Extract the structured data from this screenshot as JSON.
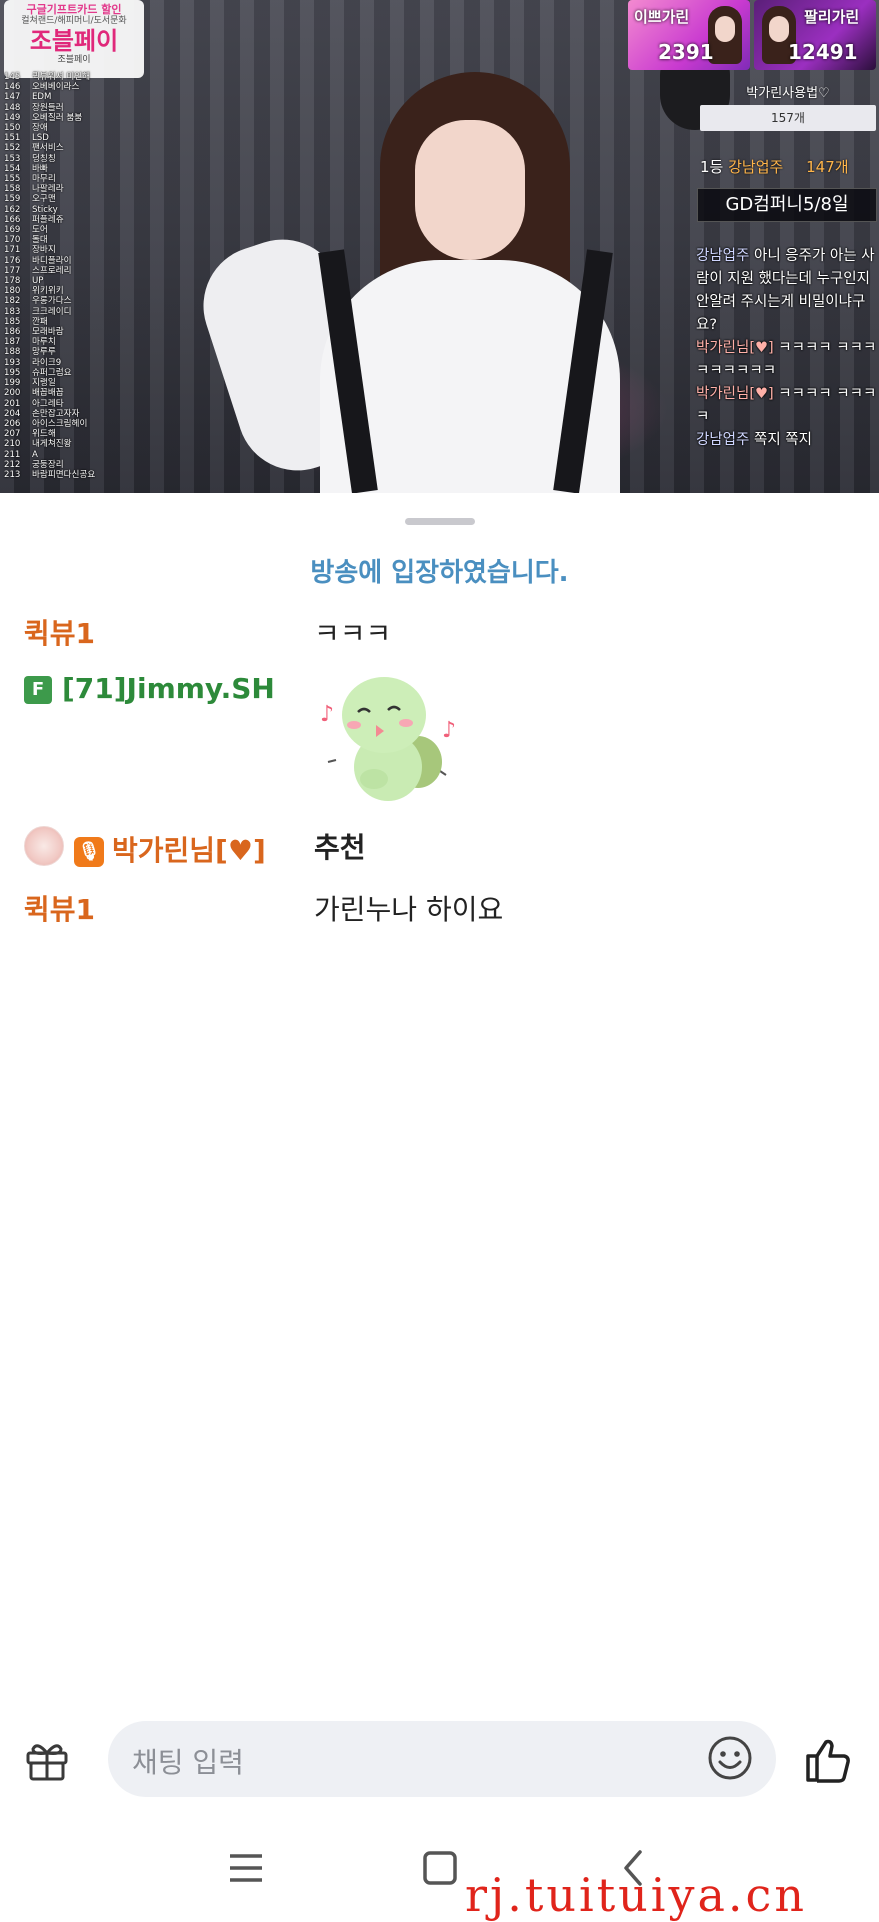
{
  "video": {
    "ad": {
      "top_line": "구글기프트카드 할인",
      "sub_line": "컬쳐랜드/해피머니/도서문화",
      "main": "조블페이",
      "foot": "조블페이"
    },
    "ranking": [
      {
        "n": "145",
        "t": "퀵뷰워셔 미인해"
      },
      {
        "n": "146",
        "t": "오베베이라스"
      },
      {
        "n": "147",
        "t": "EDM"
      },
      {
        "n": "148",
        "t": "장원들러"
      },
      {
        "n": "149",
        "t": "오베질러 붐붐"
      },
      {
        "n": "150",
        "t": "장애"
      },
      {
        "n": "151",
        "t": "LSD"
      },
      {
        "n": "152",
        "t": "팬서비스"
      },
      {
        "n": "153",
        "t": "덩칭칭"
      },
      {
        "n": "154",
        "t": "바빠"
      },
      {
        "n": "155",
        "t": "마무리"
      },
      {
        "n": "158",
        "t": "나팔레라"
      },
      {
        "n": "159",
        "t": "오구맨"
      },
      {
        "n": "162",
        "t": "Sticky"
      },
      {
        "n": "166",
        "t": "퍼플레쥬"
      },
      {
        "n": "169",
        "t": "도어"
      },
      {
        "n": "170",
        "t": "돌대"
      },
      {
        "n": "171",
        "t": "장바지"
      },
      {
        "n": "176",
        "t": "바디플라이"
      },
      {
        "n": "177",
        "t": "스프로레리"
      },
      {
        "n": "178",
        "t": "UP"
      },
      {
        "n": "180",
        "t": "위키위키"
      },
      {
        "n": "182",
        "t": "우롱가다스"
      },
      {
        "n": "183",
        "t": "크크레이디"
      },
      {
        "n": "185",
        "t": "깐패"
      },
      {
        "n": "186",
        "t": "모래바람"
      },
      {
        "n": "187",
        "t": "마루치"
      },
      {
        "n": "188",
        "t": "망루루"
      },
      {
        "n": "193",
        "t": "라이크9"
      },
      {
        "n": "195",
        "t": "슈퍼그럼요"
      },
      {
        "n": "199",
        "t": "지랭일"
      },
      {
        "n": "200",
        "t": "배꼽배꼽"
      },
      {
        "n": "201",
        "t": "아그레타"
      },
      {
        "n": "204",
        "t": "손만잡고자자"
      },
      {
        "n": "206",
        "t": "아이스크림헤이"
      },
      {
        "n": "207",
        "t": "위드해"
      },
      {
        "n": "210",
        "t": "내게쳐진왕"
      },
      {
        "n": "211",
        "t": "A"
      },
      {
        "n": "212",
        "t": "궁둥장리"
      },
      {
        "n": "213",
        "t": "바람피면다신공요"
      }
    ],
    "thumbs": [
      {
        "label": "이쁘가린",
        "num": "2391"
      },
      {
        "label": "팔리가린",
        "num": "12491"
      }
    ],
    "right_title": "박가린사용법♡",
    "right_count": "157개",
    "rank_line": {
      "rank": "1등",
      "name": "강남업주",
      "count": "147개"
    },
    "gd": "GD컴퍼니5/8일",
    "overlay_chat": [
      {
        "name": "강남업주",
        "text": "아니 응주가 아는 사람이 지원 했다는데 누구인지 안알려 주시는게 비밀이냐구요?"
      },
      {
        "name": "박가린님[♥]",
        "text": "ㅋㅋㅋㅋ ㅋㅋㅋㅋㅋㅋㅋㅋㅋ"
      },
      {
        "name": "박가린님[♥]",
        "text": "ㅋㅋㅋㅋ ㅋㅋㅋㅋ"
      },
      {
        "name": "강남업주",
        "text": "쪽지 쪽지"
      }
    ]
  },
  "chat": {
    "entered": "방송에 입장하였습니다.",
    "messages": [
      {
        "nick": "퀵뷰1",
        "text": "ㅋㅋㅋ"
      },
      {
        "badge": "F",
        "nick": "[71]Jimmy.SH",
        "sticker": "turtle-sticker"
      },
      {
        "nick": "박가린님[♥]",
        "text": "추천"
      },
      {
        "nick": "퀵뷰1",
        "text": "가린누나 하이요"
      }
    ]
  },
  "input": {
    "placeholder": "채팅 입력"
  },
  "icons": {
    "gift": "gift-icon",
    "emoji": "emoji-icon",
    "like": "thumbs-up-icon",
    "menu": "menu-icon",
    "home": "home-icon",
    "back": "back-icon"
  },
  "watermark": "rj.tuituiya.cn",
  "colors": {
    "nick": "#d9661d",
    "nick_green": "#2d8a3a",
    "entered": "#4a8fc0",
    "input_bg": "#eef0f4"
  }
}
